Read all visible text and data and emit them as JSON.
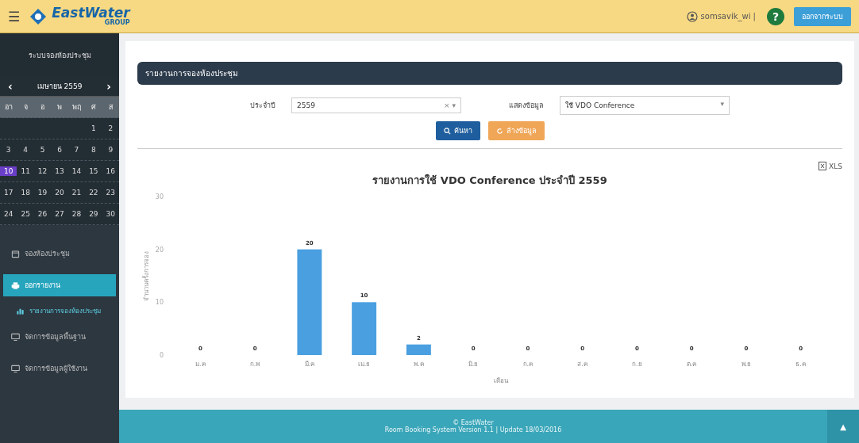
{
  "header": {
    "menu_icon": "☰",
    "brand": "EastWater",
    "brand_sub": "GROUP",
    "user": "somsavik_wi |",
    "help": "?",
    "logout": "ออกจากระบบ"
  },
  "sidebar": {
    "title": "ระบบจองห้องประชุม",
    "calendar": {
      "month": "เมษายน 2559",
      "prev": "‹",
      "next": "›",
      "weekdays": [
        "อา",
        "จ",
        "อ",
        "พ",
        "พฤ",
        "ศ",
        "ส"
      ],
      "weeks": [
        [
          {
            "kind": "empty"
          },
          {
            "kind": "empty"
          },
          {
            "kind": "empty"
          },
          {
            "kind": "empty"
          },
          {
            "kind": "empty"
          },
          {
            "kind": "day",
            "day": "1",
            "selected": false
          },
          {
            "kind": "day",
            "day": "2",
            "selected": false
          }
        ],
        [
          {
            "kind": "day",
            "day": "3",
            "selected": false
          },
          {
            "kind": "day",
            "day": "4",
            "selected": false
          },
          {
            "kind": "day",
            "day": "5",
            "selected": false
          },
          {
            "kind": "day",
            "day": "6",
            "selected": false
          },
          {
            "kind": "day",
            "day": "7",
            "selected": false
          },
          {
            "kind": "day",
            "day": "8",
            "selected": false
          },
          {
            "kind": "day",
            "day": "9",
            "selected": false
          }
        ],
        [
          {
            "kind": "day",
            "day": "10",
            "selected": true
          },
          {
            "kind": "day",
            "day": "11",
            "selected": false
          },
          {
            "kind": "day",
            "day": "12",
            "selected": false
          },
          {
            "kind": "day",
            "day": "13",
            "selected": false
          },
          {
            "kind": "day",
            "day": "14",
            "selected": false
          },
          {
            "kind": "day",
            "day": "15",
            "selected": false
          },
          {
            "kind": "day",
            "day": "16",
            "selected": false
          }
        ],
        [
          {
            "kind": "day",
            "day": "17",
            "selected": false
          },
          {
            "kind": "day",
            "day": "18",
            "selected": false
          },
          {
            "kind": "day",
            "day": "19",
            "selected": false
          },
          {
            "kind": "day",
            "day": "20",
            "selected": false
          },
          {
            "kind": "day",
            "day": "21",
            "selected": false
          },
          {
            "kind": "day",
            "day": "22",
            "selected": false
          },
          {
            "kind": "day",
            "day": "23",
            "selected": false
          }
        ],
        [
          {
            "kind": "day",
            "day": "24",
            "selected": false
          },
          {
            "kind": "day",
            "day": "25",
            "selected": false
          },
          {
            "kind": "day",
            "day": "26",
            "selected": false
          },
          {
            "kind": "day",
            "day": "27",
            "selected": false
          },
          {
            "kind": "day",
            "day": "28",
            "selected": false
          },
          {
            "kind": "day",
            "day": "29",
            "selected": false
          },
          {
            "kind": "day",
            "day": "30",
            "selected": false
          }
        ]
      ]
    },
    "items": [
      {
        "label": "จองห้องประชุม",
        "selected": false
      },
      {
        "label": "ออกรายงาน",
        "selected": true,
        "children": [
          {
            "label": "รายงานการจองห้องประชุม"
          }
        ]
      },
      {
        "label": "จัดการข้อมูลพื้นฐาน",
        "selected": false
      },
      {
        "label": "จัดการข้อมูลผู้ใช้งาน",
        "selected": false
      }
    ]
  },
  "panel": {
    "title": "รายงานการจองห้องประชุม",
    "filters": [
      {
        "label": "ประจำปี",
        "value": "2559",
        "clear": "×",
        "caret": "▾"
      },
      {
        "label": "แสดงข้อมูล",
        "value": "ใช้ VDO Conference",
        "caret": "▾"
      }
    ],
    "buttons": [
      {
        "label": "ค้นหา",
        "kind": "search"
      },
      {
        "label": "ล้างข้อมูล",
        "kind": "reset"
      }
    ],
    "export": "XLS",
    "chart_data": {
      "type": "bar",
      "title": "รายงานการใช้ VDO Conference ประจำปี 2559",
      "xlabel": "เดือน",
      "ylabel": "จำนวนครั้งการจอง",
      "categories": [
        "ม.ค",
        "ก.พ",
        "มี.ค",
        "เม.ย",
        "พ.ค",
        "มิ.ย",
        "ก.ค",
        "ส.ค",
        "ก.ย",
        "ต.ค",
        "พ.ย",
        "ธ.ค"
      ],
      "values": [
        0,
        0,
        20,
        10,
        2,
        0,
        0,
        0,
        0,
        0,
        0,
        0
      ],
      "ylim": [
        0,
        30
      ],
      "yticks": [
        0,
        10,
        20,
        30
      ],
      "data_labels": true
    }
  },
  "footer": {
    "copyright": "© EastWater",
    "version": "Room Booking System Version 1.1 | Update 18/03/2016",
    "top": "▲"
  }
}
